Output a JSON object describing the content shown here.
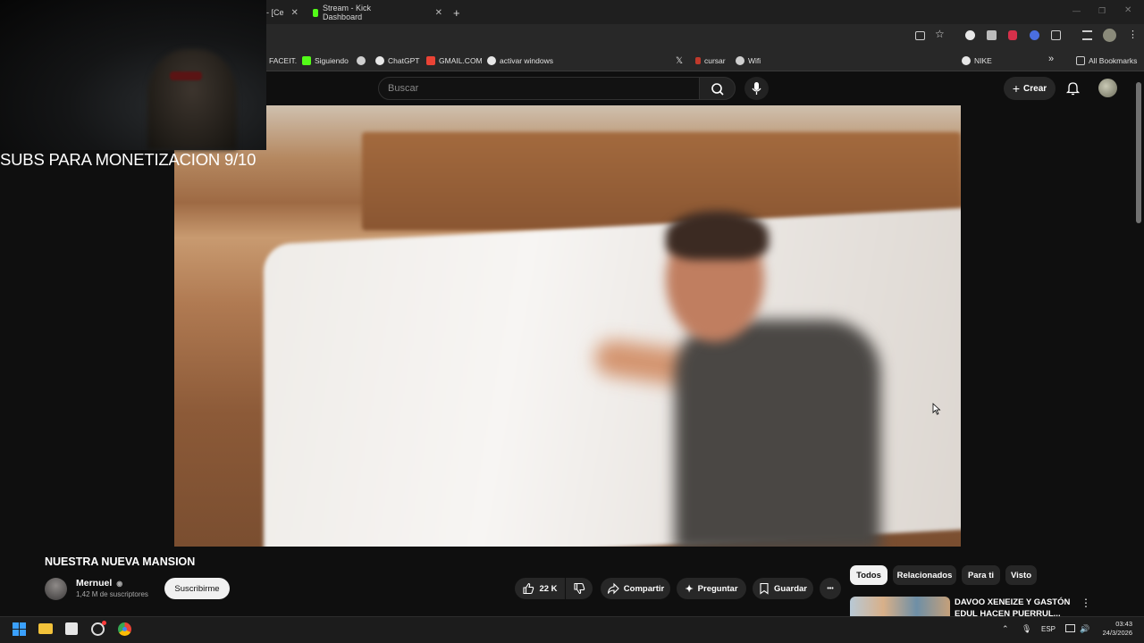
{
  "browser": {
    "tabs": [
      {
        "label": "- [Ce"
      },
      {
        "label": "Stream - Kick Dashboard"
      }
    ],
    "new_tab": "+",
    "bookmarks": [
      {
        "label": "FACEIT."
      },
      {
        "label": "Siguiendo"
      },
      {
        "label": "ChatGPT"
      },
      {
        "label": "GMAIL.COM"
      },
      {
        "label": "activar windows"
      },
      {
        "label": "cursar"
      },
      {
        "label": "Wifi"
      },
      {
        "label": "NIKE"
      }
    ],
    "more_bookmarks": "»",
    "all_bookmarks": "All Bookmarks"
  },
  "youtube": {
    "search_placeholder": "Buscar",
    "create_label": "Crear"
  },
  "overlay": {
    "subs_goal": "SUBS PARA MONETIZACION 9/10"
  },
  "video": {
    "title": "NUESTRA NUEVA MANSION",
    "channel_name": "Mernuel",
    "channel_verified": "◉",
    "subscribers": "1,42 M de suscriptores",
    "subscribe_label": "Suscribirme",
    "likes": "22 K",
    "share_label": "Compartir",
    "ask_label": "Preguntar",
    "save_label": "Guardar",
    "more_label": "•••"
  },
  "sidebar": {
    "chips": [
      "Todos",
      "Relacionados",
      "Para ti",
      "Visto"
    ],
    "recommendation_title": "DAVOO XENEIZE Y GASTÓN EDUL HACEN PUERRUL..."
  },
  "taskbar": {
    "language": "ESP",
    "time": "03:43",
    "date": "24/3/2026"
  },
  "colors": {
    "background": "#0f0f0f",
    "kick_green": "#53fc18",
    "chrome_dark": "#1f1f1f"
  }
}
